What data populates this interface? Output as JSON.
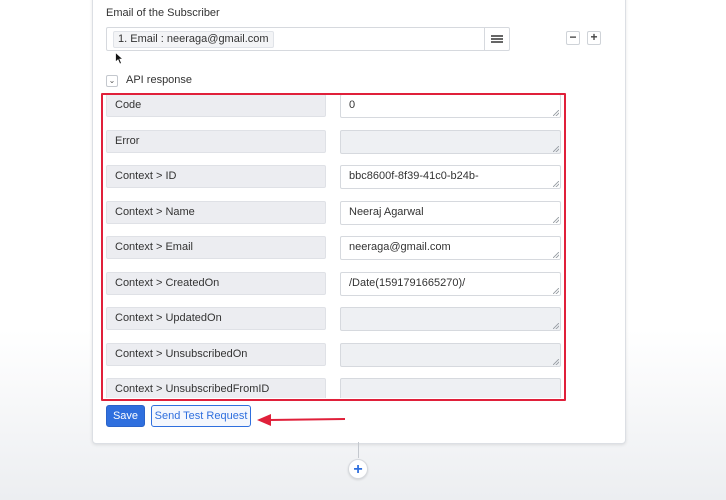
{
  "email_field": {
    "label": "Email of the Subscriber",
    "chip": "1. Email : neeraga@gmail.com",
    "minus": "−",
    "plus": "+"
  },
  "api_response": {
    "toggle_label": "API response",
    "rows": [
      {
        "key": "Code",
        "value": "0"
      },
      {
        "key": "Error",
        "value": ""
      },
      {
        "key": "Context > ID",
        "value": "bbc8600f-8f39-41c0-b24b-"
      },
      {
        "key": "Context > Name",
        "value": "Neeraj Agarwal"
      },
      {
        "key": "Context > Email",
        "value": "neeraga@gmail.com"
      },
      {
        "key": "Context > CreatedOn",
        "value": "/Date(1591791665270)/"
      },
      {
        "key": "Context > UpdatedOn",
        "value": ""
      },
      {
        "key": "Context > UnsubscribedOn",
        "value": ""
      },
      {
        "key": "Context > UnsubscribedFromID",
        "value": ""
      }
    ]
  },
  "actions": {
    "save_label": "Save",
    "send_test_label": "Send Test Request"
  },
  "add_step": {
    "label": "+"
  },
  "colors": {
    "highlight": "#e0203a",
    "primary": "#2f6fde"
  }
}
